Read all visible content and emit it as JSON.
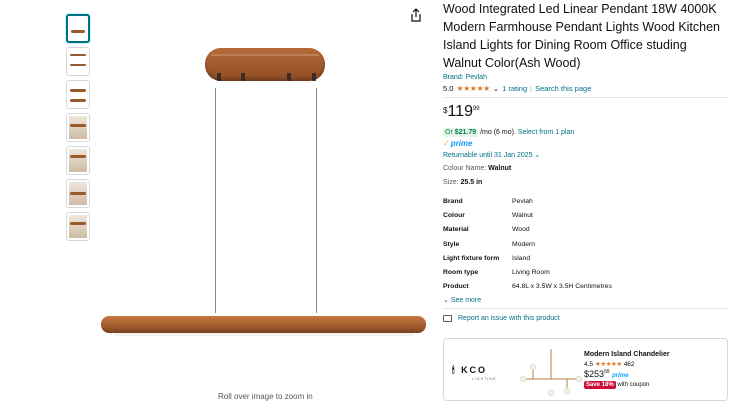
{
  "share_icon": "share-icon",
  "zoom_hint": "Roll over image to zoom in",
  "product": {
    "title": "Wood Integrated Led Linear Pendant 18W 4000K Modern Farmhouse Pendant Lights Wood Kitchen Island Lights for Dining Room Office studing Walnut Color(Ash Wood)",
    "brand": "Brand: Pevlah",
    "rating_value": "5.0",
    "rating_stars": "★★★★★",
    "rating_count": "1 rating",
    "search_page": "Search this page",
    "price_currency": "$",
    "price_whole": "119",
    "price_fraction": "99",
    "emi_or": "Or",
    "emi_amount": "$21.79",
    "emi_term": " /mo (6 mo). ",
    "emi_link": "Select from 1 plan",
    "prime": "prime",
    "returnable": "Returnable until 31 Jan 2025",
    "colour_label": "Colour Name:",
    "colour_value": "Walnut",
    "size_label": "Size:",
    "size_value": "25.5 in"
  },
  "specs": [
    {
      "key": "Brand",
      "value": "Pevlah"
    },
    {
      "key": "Colour",
      "value": "Walnut"
    },
    {
      "key": "Material",
      "value": "Wood"
    },
    {
      "key": "Style",
      "value": "Modern"
    },
    {
      "key": "Light fixture form",
      "value": "Island"
    },
    {
      "key": "Room type",
      "value": "Living Room"
    },
    {
      "key": "Product",
      "value": "64.8L x 3.5W x 3.5H Centimetres"
    }
  ],
  "see_more": "See more",
  "report_issue": "Report an issue with this product",
  "sponsored": {
    "brand_logo": "KCO",
    "brand_sub": "LIGHTING",
    "name": "Modern Island Chandelier",
    "rating": "4.5",
    "stars": "★★★★★",
    "count": "462",
    "price_whole": "$253",
    "price_fraction": "99",
    "prime": "prime",
    "save_badge": "Save 18%",
    "coupon_text": "with coupon"
  }
}
